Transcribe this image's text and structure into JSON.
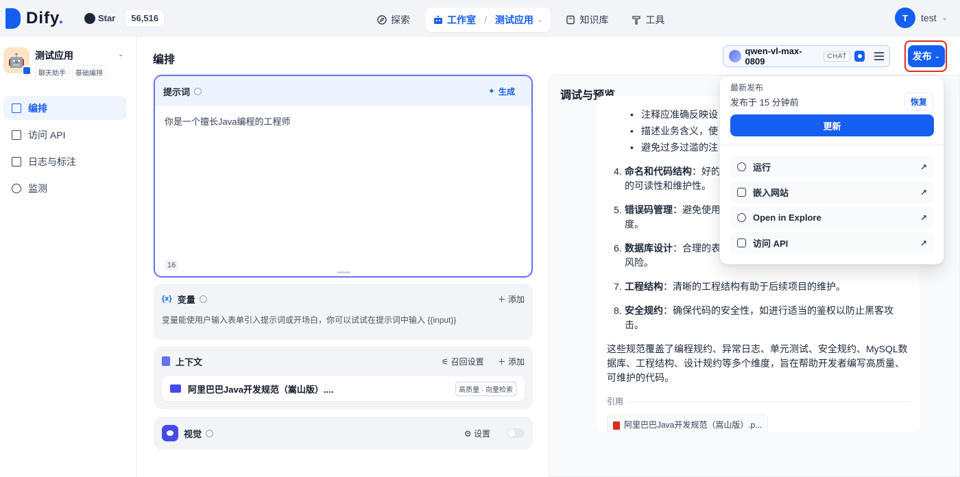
{
  "topbar": {
    "brand": "Dify",
    "brand_accent": ".",
    "star_label": "Star",
    "star_count": "56,516",
    "nav": {
      "explore": "探索",
      "studio": "工作室",
      "current_app": "测试应用",
      "knowledge": "知识库",
      "tools": "工具"
    },
    "user": {
      "initial": "T",
      "name": "test"
    }
  },
  "sidebar": {
    "app_name": "测试应用",
    "tags": [
      "聊天助手",
      "基础编排"
    ],
    "items": [
      {
        "label": "编排"
      },
      {
        "label": "访问 API"
      },
      {
        "label": "日志与标注"
      },
      {
        "label": "监测"
      }
    ]
  },
  "main": {
    "title": "编排",
    "model": {
      "name": "qwen-vl-max-0809",
      "mode": "CHAT"
    },
    "publish_label": "发布"
  },
  "prompt": {
    "label": "提示词",
    "generate_label": "生成",
    "text": "你是一个擅长Java编程的工程师",
    "count": "16"
  },
  "variables": {
    "icon": "{x}",
    "label": "变量",
    "add_label": "添加",
    "desc": "变量能使用户输入表单引入提示词或开场白，你可以试试在提示词中输入 {{input}}"
  },
  "context": {
    "label": "上下文",
    "recall_label": "召回设置",
    "add_label": "添加",
    "kb_name": "阿里巴巴Java开发规范（嵩山版）....",
    "kb_tag": "高质量 · 向量检索"
  },
  "vision": {
    "label": "视觉",
    "settings_label": "设置"
  },
  "preview": {
    "title": "调试与预览",
    "sub_items": [
      "注释应准确反映设",
      "描述业务含义，使",
      "避免过多过滥的注"
    ],
    "points": [
      {
        "num": "4.",
        "title": "命名和代码结构",
        "text": "：好的",
        "cont": "的可读性和维护性。"
      },
      {
        "num": "5.",
        "title": "错误码管理",
        "text": "：避免使用",
        "cont": "度。"
      },
      {
        "num": "6.",
        "title": "数据库设计",
        "text": "：合理的表",
        "cont": "风险。"
      },
      {
        "num": "7.",
        "title": "工程结构",
        "text": "：清晰的工程结构有助于后续项目的维护。",
        "cont": ""
      },
      {
        "num": "8.",
        "title": "安全规约",
        "text": "：确保代码的安全性，如进行适当的鉴权以防止黑客攻击。",
        "cont": ""
      }
    ],
    "summary": "这些规范覆盖了编程规约、异常日志、单元测试、安全规约、MySQL数据库、工程结构、设计规约等多个维度，旨在帮助开发者编写高质量、可维护的代码。",
    "cite_label": "引用",
    "cite_file": "阿里巴巴Java开发规范（嵩山版）.p..."
  },
  "dropdown": {
    "latest_label": "最新发布",
    "published_time": "发布于 15 分钟前",
    "restore_label": "恢复",
    "update_label": "更新",
    "items": [
      {
        "label": "运行"
      },
      {
        "label": "嵌入网站"
      },
      {
        "label": "Open in Explore"
      },
      {
        "label": "访问 API"
      }
    ]
  }
}
